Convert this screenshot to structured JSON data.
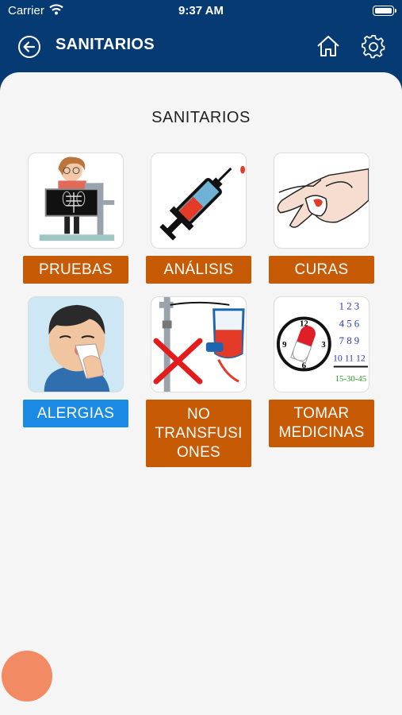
{
  "status_bar": {
    "carrier": "Carrier",
    "time": "9:37 AM"
  },
  "nav": {
    "title": "SANITARIOS"
  },
  "section": {
    "title": "SANITARIOS"
  },
  "tiles": [
    {
      "label": "PRUEBAS",
      "color": "#c75a05",
      "icon": "xray-doctor-icon"
    },
    {
      "label": "ANÁLISIS",
      "color": "#c75a05",
      "icon": "syringe-icon"
    },
    {
      "label": "CURAS",
      "color": "#c75a05",
      "icon": "bandaged-hand-icon"
    },
    {
      "label": "ALERGIAS",
      "color": "#1a8ae4",
      "icon": "sneezing-person-icon"
    },
    {
      "label": "NO TRANSFUSI ONES",
      "color": "#c75a05",
      "icon": "no-transfusion-icon"
    },
    {
      "label": "TOMAR MEDICINAS",
      "color": "#c75a05",
      "icon": "pill-clock-icon"
    }
  ],
  "clock_numbers": [
    "12",
    "9",
    "3",
    "6"
  ],
  "schedule": {
    "rows": [
      "1 2 3",
      "4 5 6",
      "7 8 9",
      "10 11 12"
    ],
    "footer": "15-30-45"
  },
  "colors": {
    "header": "#053a73",
    "content_bg": "#f5f5f5",
    "fab": "#f28a63"
  }
}
